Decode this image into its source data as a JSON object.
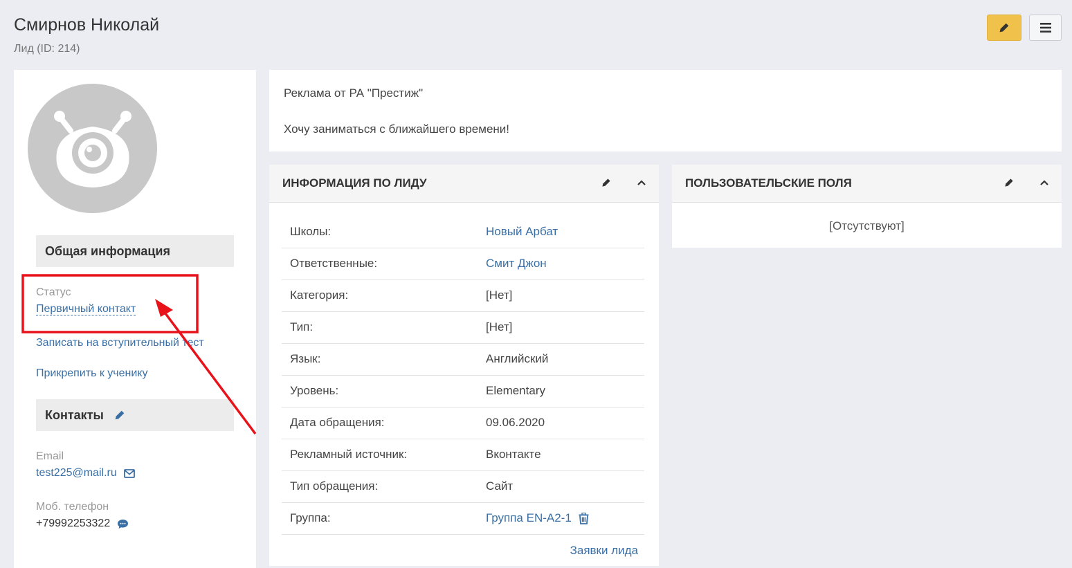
{
  "header": {
    "title": "Смирнов Николай",
    "subtitle": "Лид (ID: 214)"
  },
  "sidebar": {
    "general_heading": "Общая информация",
    "status_label": "Статус",
    "status_value": "Первичный контакт",
    "enroll_test_link": "Записать на вступительный тест",
    "attach_student_link": "Прикрепить к ученику",
    "contacts_heading": "Контакты",
    "email_label": "Email",
    "email_value": "test225@mail.ru",
    "phone_label": "Моб. телефон",
    "phone_value": "+79992253322"
  },
  "note": {
    "line1": "Реклама от РА \"Престиж\"",
    "line2": "Хочу заниматься с ближайшего времени!"
  },
  "lead_info": {
    "title": "ИНФОРМАЦИЯ ПО ЛИДУ",
    "rows": [
      {
        "label": "Школы:",
        "value": "Новый Арбат",
        "link": true
      },
      {
        "label": "Ответственные:",
        "value": "Смит Джон",
        "link": true
      },
      {
        "label": "Категория:",
        "value": "[Нет]",
        "link": false
      },
      {
        "label": "Тип:",
        "value": "[Нет]",
        "link": false
      },
      {
        "label": "Язык:",
        "value": "Английский",
        "link": false
      },
      {
        "label": "Уровень:",
        "value": "Elementary",
        "link": false
      },
      {
        "label": "Дата обращения:",
        "value": "09.06.2020",
        "link": false
      },
      {
        "label": "Рекламный источник:",
        "value": "Вконтакте",
        "link": false
      },
      {
        "label": "Тип обращения:",
        "value": "Сайт",
        "link": false
      },
      {
        "label": "Группа:",
        "value": "Группа EN-A2-1",
        "link": true
      }
    ],
    "requests_link": "Заявки лида"
  },
  "custom_fields": {
    "title": "ПОЛЬЗОВАТЕЛЬСКИЕ ПОЛЯ",
    "empty_text": "[Отсутствуют]"
  },
  "colors": {
    "accent_yellow": "#f0c14b",
    "link_blue": "#3a6fa5",
    "annotation_red": "#e8131a"
  }
}
